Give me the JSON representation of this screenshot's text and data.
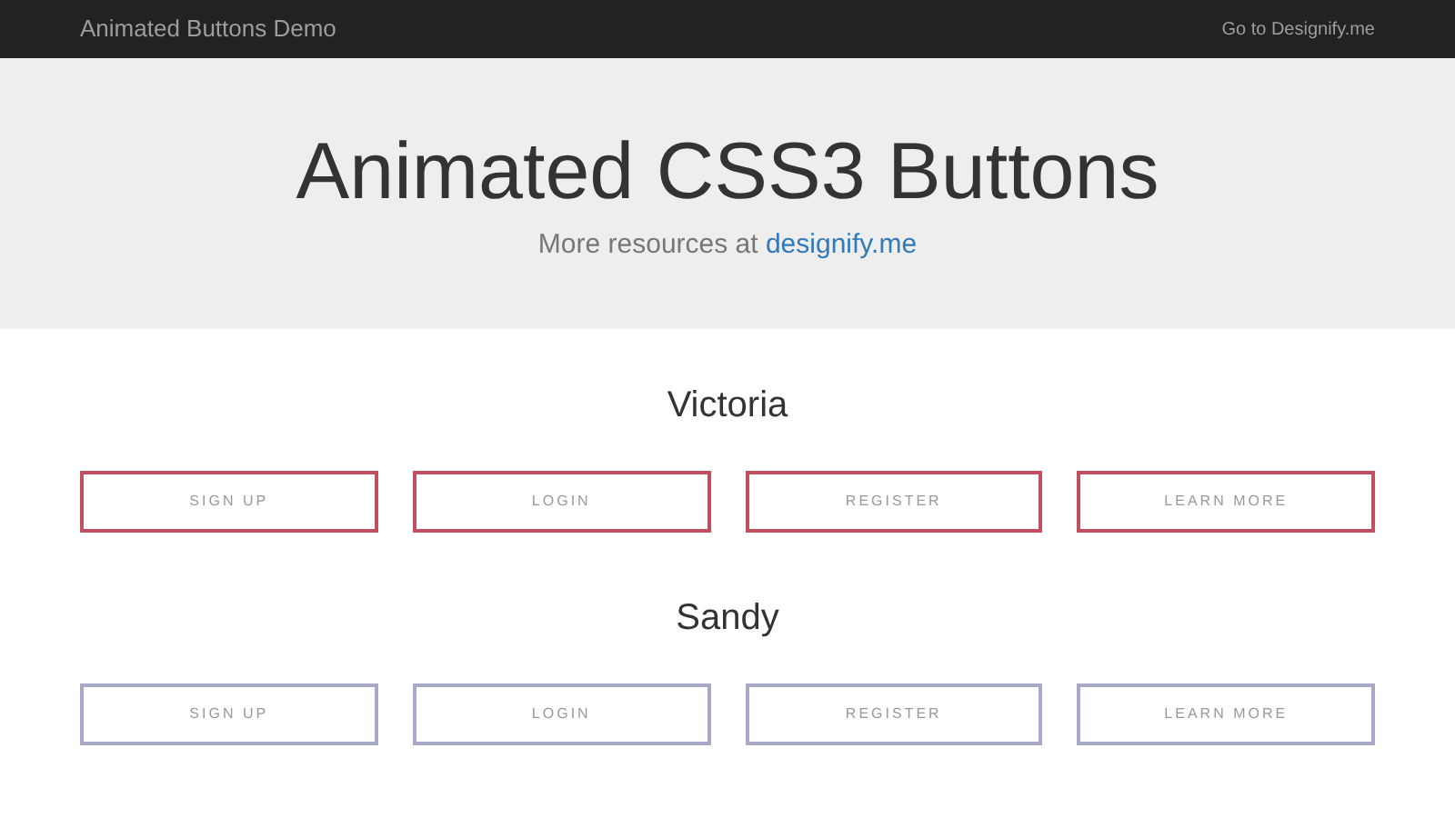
{
  "navbar": {
    "brand": "Animated Buttons Demo",
    "link": "Go to Designify.me"
  },
  "hero": {
    "title": "Animated CSS3 Buttons",
    "subtitle": "More resources at ",
    "subtitle_link": "designify.me"
  },
  "groups": [
    {
      "title": "Victoria",
      "color": "#c0505f",
      "buttons": [
        "SIGN UP",
        "LOGIN",
        "REGISTER",
        "LEARN MORE"
      ]
    },
    {
      "title": "Sandy",
      "color": "#a8a8c8",
      "buttons": [
        "SIGN UP",
        "LOGIN",
        "REGISTER",
        "LEARN MORE"
      ]
    }
  ]
}
